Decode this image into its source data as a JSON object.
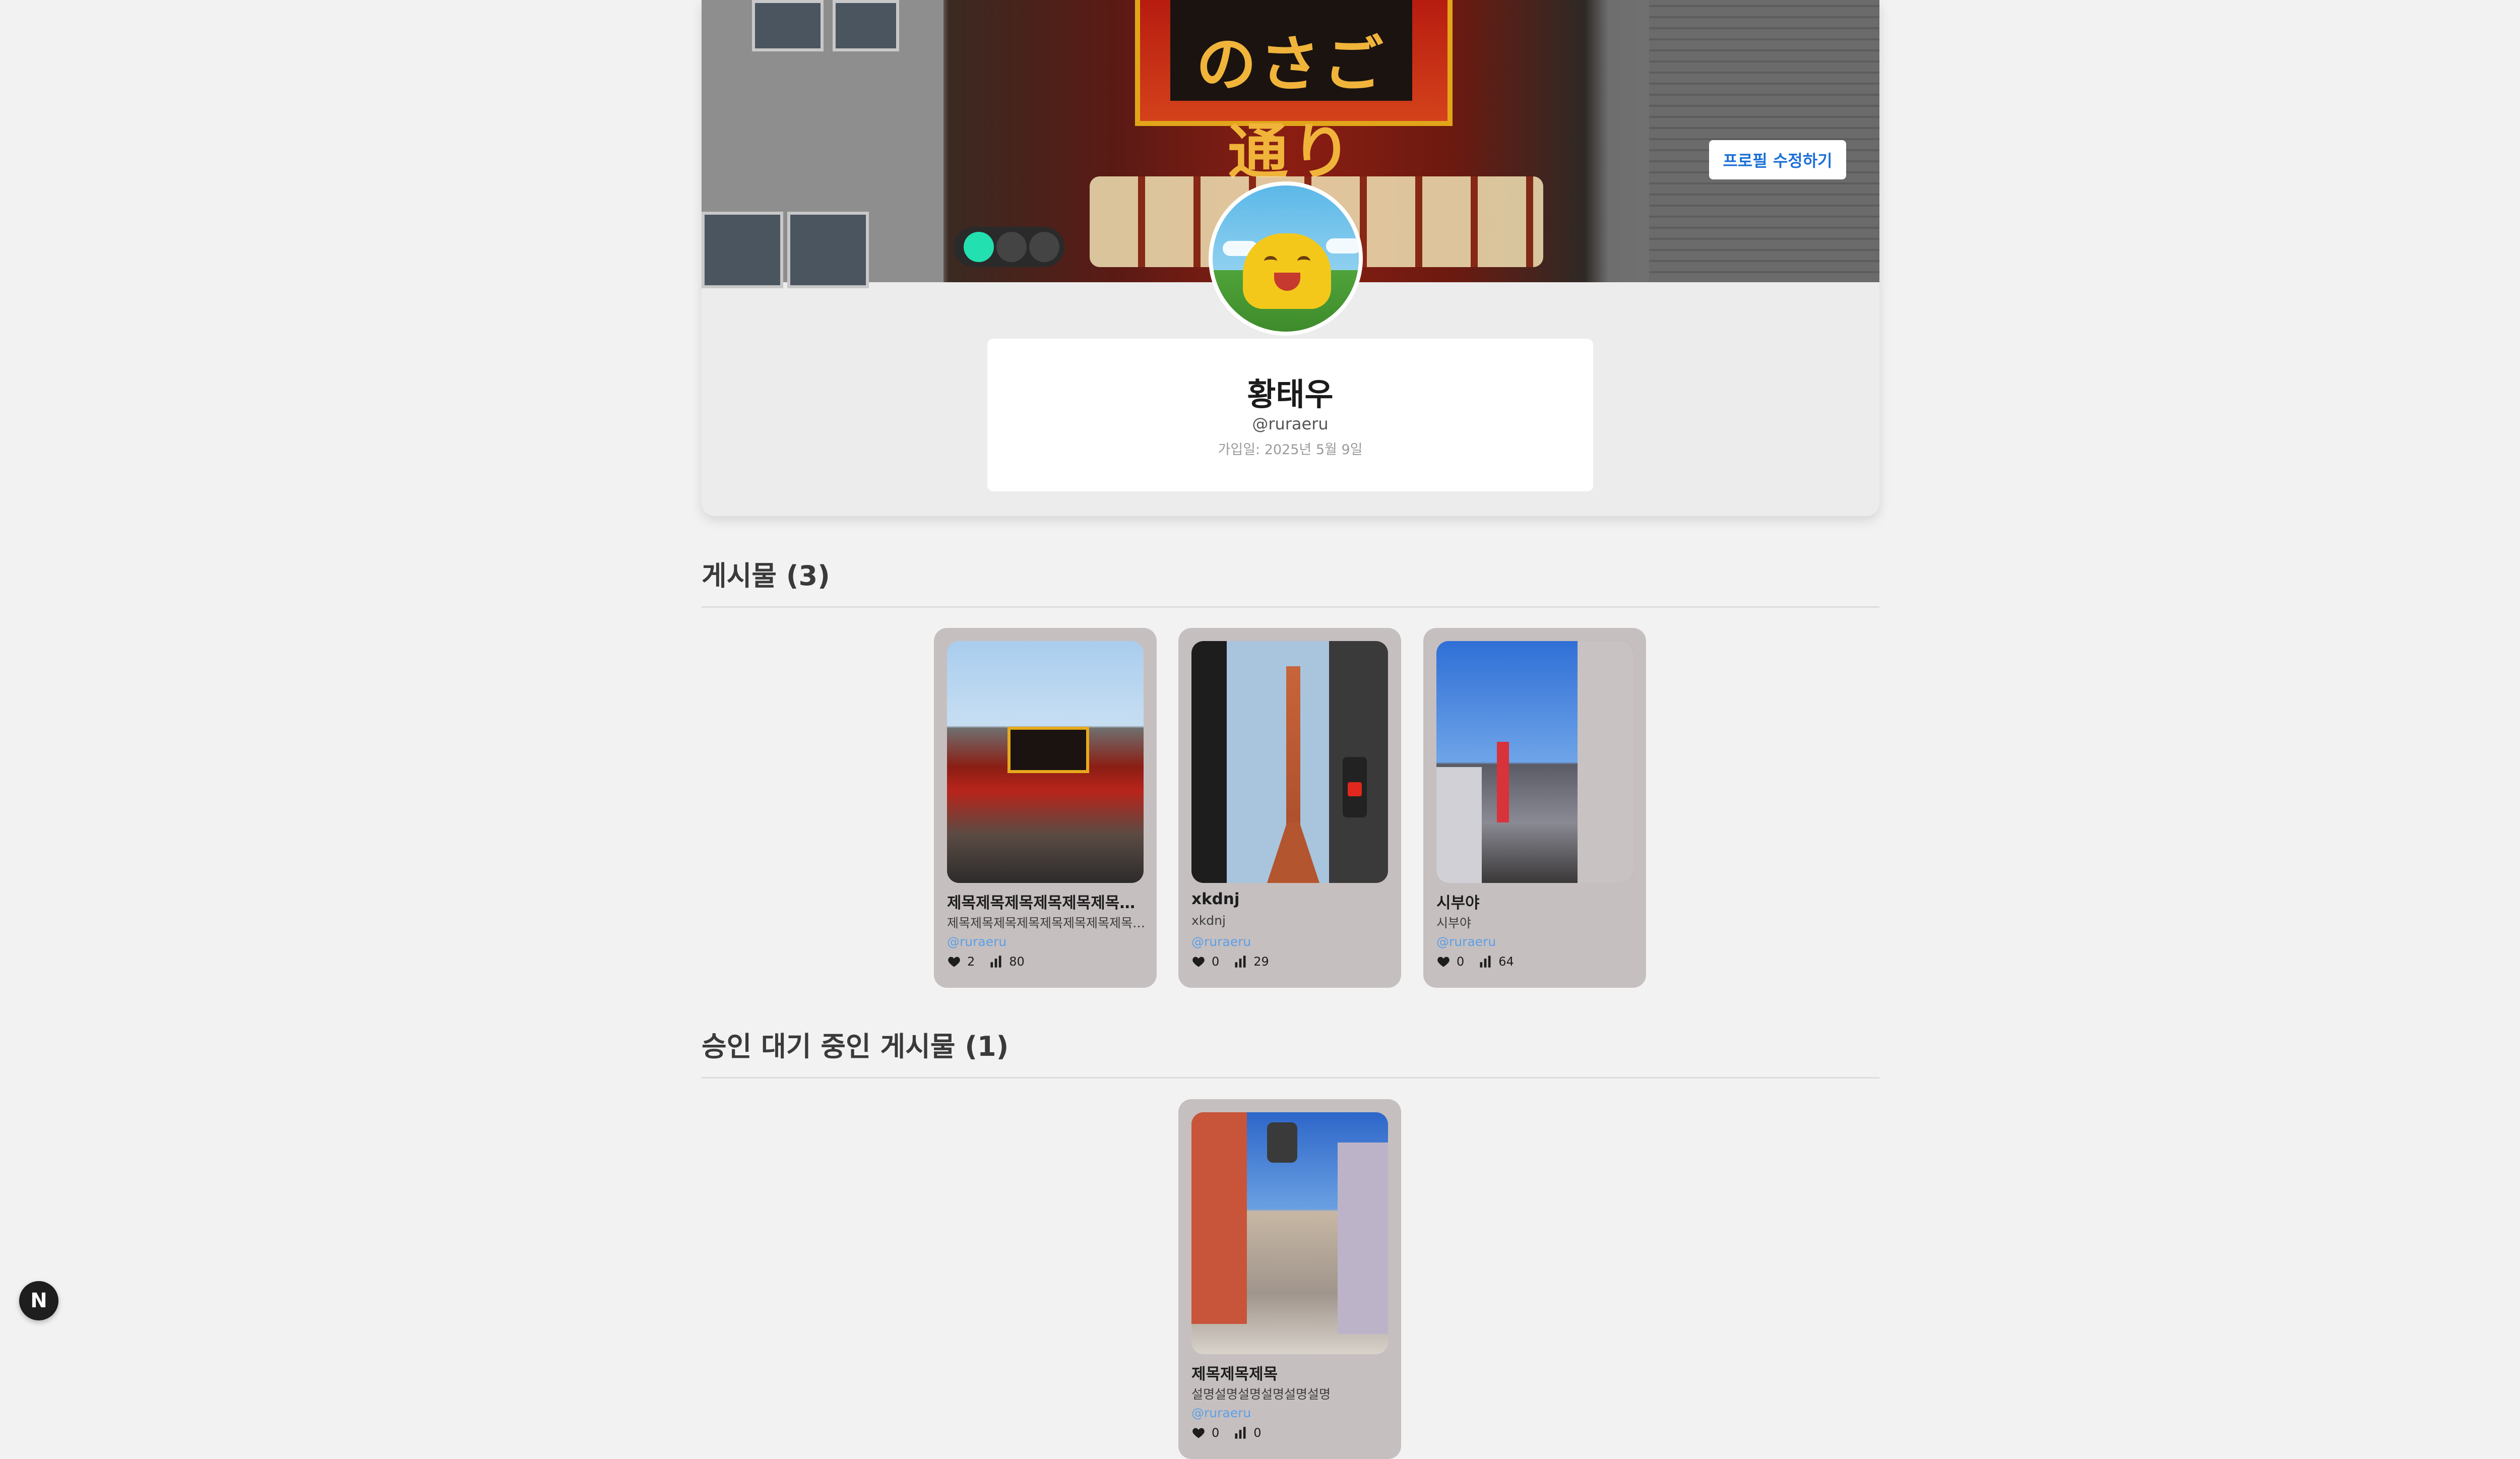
{
  "profile": {
    "cover_sign_text": "のさご通り",
    "edit_button_label": "프로필 수정하기",
    "name": "황태우",
    "handle": "@ruraeru",
    "joined": "가입일: 2025년 5월 9일"
  },
  "posts_section": {
    "title": "게시물 (3)",
    "posts": [
      {
        "title": "제목제목제목제목제목제목제목제목제목제목",
        "description": "제목제목제목제목제목제목제목제목제목제목제목",
        "author": "@ruraeru",
        "likes": "2",
        "views": "80"
      },
      {
        "title": "xkdnj",
        "description": "xkdnj",
        "author": "@ruraeru",
        "likes": "0",
        "views": "29"
      },
      {
        "title": "시부야",
        "description": "시부야",
        "author": "@ruraeru",
        "likes": "0",
        "views": "64"
      }
    ]
  },
  "pending_section": {
    "title": "승인 대기 중인 게시물 (1)",
    "posts": [
      {
        "title": "제목제목제목",
        "description": "설명설명설명설명설명설명",
        "author": "@ruraeru",
        "likes": "0",
        "views": "0"
      }
    ]
  },
  "dev_badge": {
    "label": "N"
  },
  "colors": {
    "accent": "#1a6fd6",
    "author_link": "#5aa0e8",
    "card_bg": "#c6bfbf"
  }
}
